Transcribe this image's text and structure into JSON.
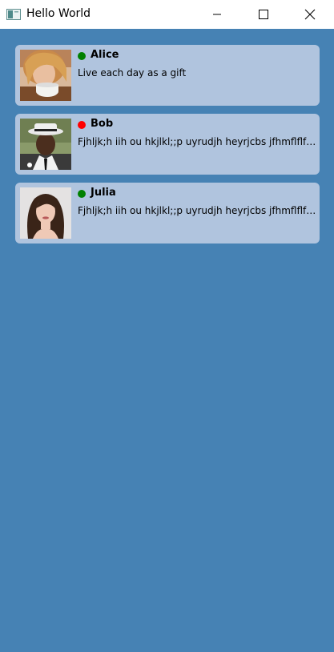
{
  "window": {
    "title": "Hello World",
    "controls": [
      "minimize-icon",
      "maximize-icon",
      "close-icon"
    ]
  },
  "contacts": [
    {
      "name": "Alice",
      "status": "online",
      "status_color": "#008000",
      "message": "Live each day as a gift"
    },
    {
      "name": "Bob",
      "status": "offline",
      "status_color": "#ff0000",
      "message": "Fjhljk;h iih  ou hkjlkl;;p uyrudjh heyrjcbs jfhmflflf;fkfkfkf"
    },
    {
      "name": "Julia",
      "status": "online",
      "status_color": "#008000",
      "message": "Fjhljk;h iih  ou hkjlkl;;p uyrudjh heyrjcbs jfhmflflf;fkfkfkf"
    }
  ],
  "colors": {
    "background": "#4682b4",
    "card": "#b0c4de",
    "titlebar": "#ffffff"
  }
}
